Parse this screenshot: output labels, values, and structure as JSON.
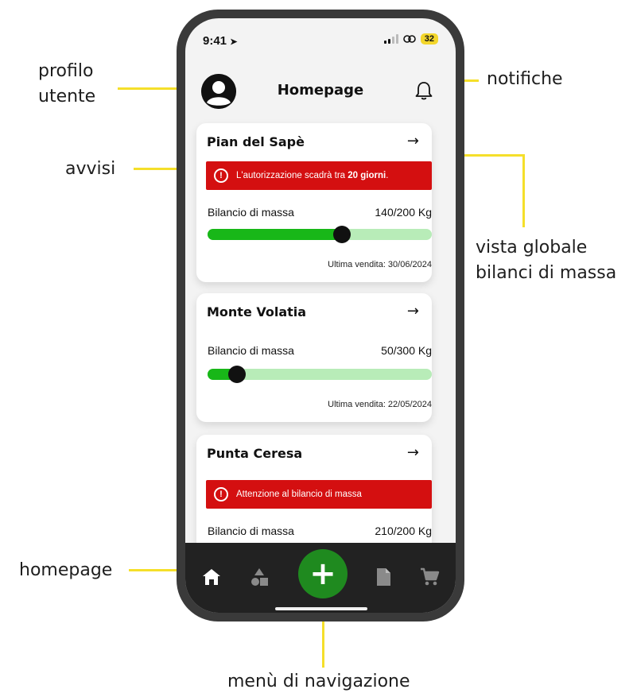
{
  "annotations": {
    "profile": "profilo\nutente",
    "notifications": "notifiche",
    "alerts": "avvisi",
    "global_view": "vista globale\nbilanci di massa",
    "homepage": "homepage",
    "nav_menu": "menù di navigazione"
  },
  "status_bar": {
    "time": "9:41",
    "battery": "32"
  },
  "header": {
    "title": "Homepage"
  },
  "cards": [
    {
      "title": "Pian del Sapè",
      "arrow": "→",
      "alert_prefix": "L'autorizzazione scadrà tra ",
      "alert_bold": "20 giorni",
      "alert_suffix": ".",
      "balance_label": "Bilancio di massa",
      "balance_value": "140/200 Kg",
      "progress": 0.6,
      "last_sale": "Ultima vendita: 30/06/2024"
    },
    {
      "title": "Monte Volatia",
      "arrow": "→",
      "balance_label": "Bilancio di massa",
      "balance_value": "50/300 Kg",
      "progress": 0.13,
      "last_sale": "Ultima vendita: 22/05/2024"
    },
    {
      "title": "Punta Ceresa",
      "arrow": "→",
      "alert": "Attenzione al bilancio di massa",
      "balance_label": "Bilancio di massa",
      "balance_value": "210/200 Kg"
    }
  ],
  "nav": {
    "items": [
      "home-icon",
      "shapes-icon",
      "add-icon",
      "document-icon",
      "cart-icon"
    ],
    "fab_label": "+"
  },
  "colors": {
    "accent_yellow": "#f5df2a",
    "alert_red": "#d40f10",
    "progress_green": "#18b718",
    "progress_track": "#b8ecb8",
    "fab_green": "#1f8a1f",
    "nav_bg": "#222222"
  }
}
